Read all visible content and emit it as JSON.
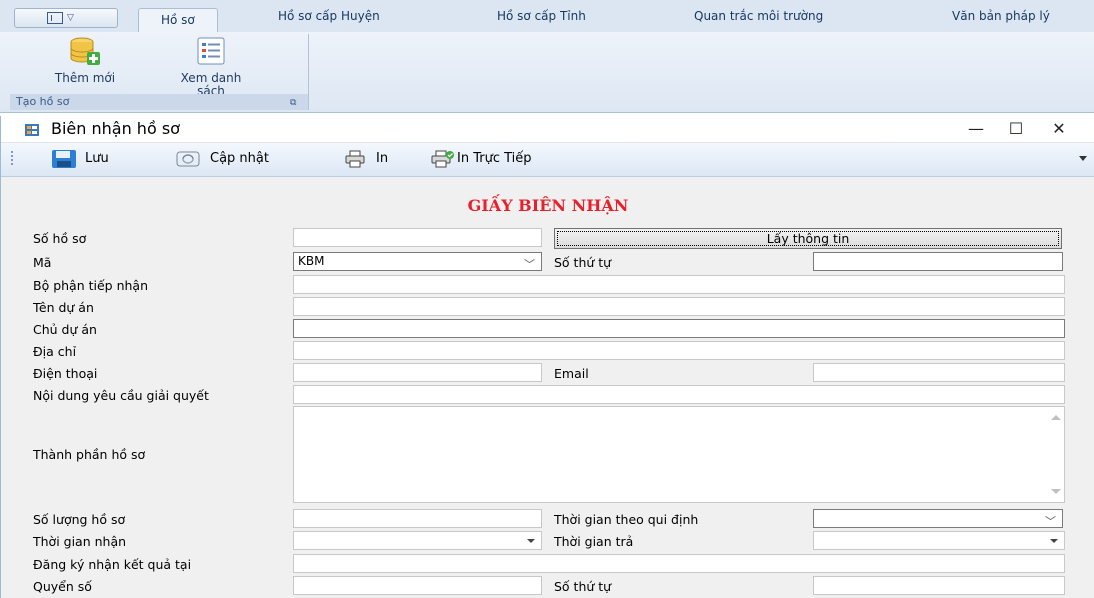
{
  "ribbon": {
    "tabs": [
      "Hồ sơ",
      "Hồ sơ cấp Huyện",
      "Hồ sơ cấp Tỉnh",
      "Quan trắc môi trường",
      "Văn bản pháp lý"
    ],
    "buttons": {
      "add": "Thêm mới",
      "list_line1": "Xem danh",
      "list_line2": "sách"
    },
    "group_label": "Tạo hồ sơ"
  },
  "window": {
    "title": "Biên nhận hồ sơ",
    "controls": {
      "minimize": "—",
      "maximize": "☐",
      "close": "✕"
    }
  },
  "toolbar": {
    "save": "Lưu",
    "update": "Cập nhật",
    "print": "In",
    "print_direct": "In Trực Tiếp"
  },
  "form": {
    "title": "GIẤY BIÊN NHẬN",
    "labels": {
      "so_ho_so": "Số hồ sơ",
      "ma": "Mã",
      "so_thu_tu": "Số thứ tự",
      "bo_phan": "Bộ phận tiếp nhận",
      "ten_du_an": "Tên dự án",
      "chu_du_an": "Chủ dự án",
      "dia_chi": "Địa chỉ",
      "dien_thoai": "Điện thoại",
      "email": "Email",
      "noi_dung": "Nội dung yêu cầu giải quyết",
      "thanh_phan": "Thành phần hồ sơ",
      "so_luong": "Số lượng hồ sơ",
      "tg_qui_dinh": "Thời gian theo qui định",
      "tg_nhan": "Thời gian nhận",
      "tg_tra": "Thời gian trả",
      "dang_ky": "Đăng ký nhận kết quả tại",
      "quyen_so": "Quyển số",
      "so_thu_tu_2": "Số thứ tự"
    },
    "buttons": {
      "lay_thong_tin": "Lấy thông tin"
    },
    "values": {
      "ma": "KBM"
    }
  },
  "colors": {
    "form_title": "#e8202b",
    "ribbon_bg": "#dce6f2",
    "toolbar_bg": "#dce7f5"
  }
}
